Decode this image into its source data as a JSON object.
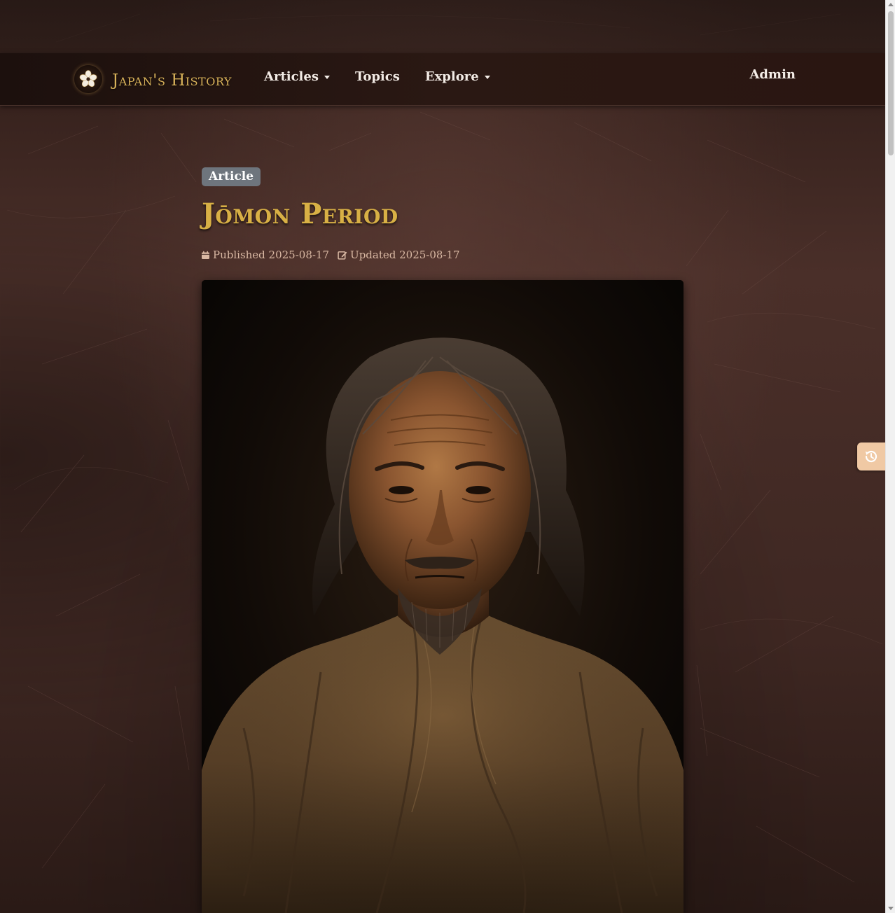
{
  "nav": {
    "brand": "Japan's History",
    "items": [
      {
        "label": "Articles",
        "dropdown": true
      },
      {
        "label": "Topics",
        "dropdown": false
      },
      {
        "label": "Explore",
        "dropdown": true
      }
    ],
    "admin": "Admin"
  },
  "article": {
    "badge": "Article",
    "title": "Jōmon Period",
    "published": "Published 2025-08-17",
    "updated": "Updated 2025-08-17",
    "hero_image_alt": "Portrait of a weathered Jōmon-era man"
  },
  "icons": {
    "logo": "sakura-crest-icon",
    "published": "calendar-icon",
    "updated": "edit-icon",
    "history": "history-icon"
  },
  "colors": {
    "brand_gold": "#d9b25a",
    "title_gold": "#d8b045",
    "badge_bg": "#6e757d",
    "meta_text": "#d9b8a3",
    "history_button": "#f0c9a4"
  }
}
